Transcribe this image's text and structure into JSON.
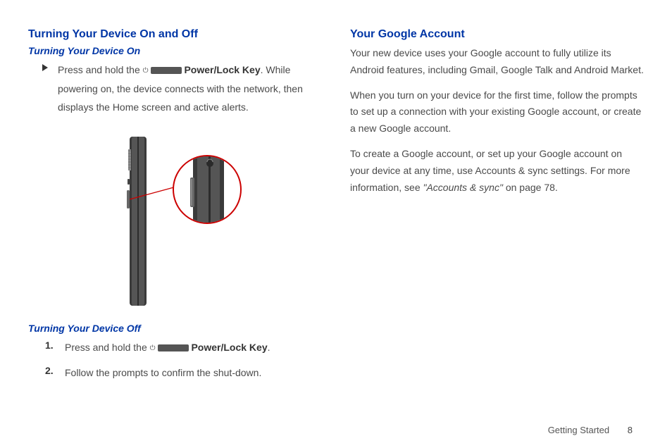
{
  "left": {
    "h1": "Turning Your Device On and Off",
    "h2a": "Turning Your Device On",
    "on_pre": "Press and hold the ",
    "power_key_label": "Power/Lock Key",
    "on_post": ". While powering on, the device connects with the network, then displays the Home screen and active alerts.",
    "h2b": "Turning Your Device Off",
    "off_steps": [
      {
        "n": "1.",
        "pre": "Press and hold the ",
        "key": "Power/Lock Key",
        "post": "."
      },
      {
        "n": "2.",
        "text": "Follow the prompts to confirm the shut-down."
      }
    ]
  },
  "right": {
    "h1": "Your Google Account",
    "p1": "Your new device uses your Google account to fully utilize its Android features, including Gmail, Google Talk and Android Market.",
    "p2": "When you turn on your device for the first time, follow the prompts to set up a connection with your existing Google account, or create a new Google account.",
    "p3_pre": "To create a Google account, or set up your Google account on your device at any time, use Accounts & sync settings. For more information, see ",
    "p3_ref": "\"Accounts & sync\"",
    "p3_post": " on page 78."
  },
  "footer": {
    "section": "Getting Started",
    "page": "8"
  }
}
